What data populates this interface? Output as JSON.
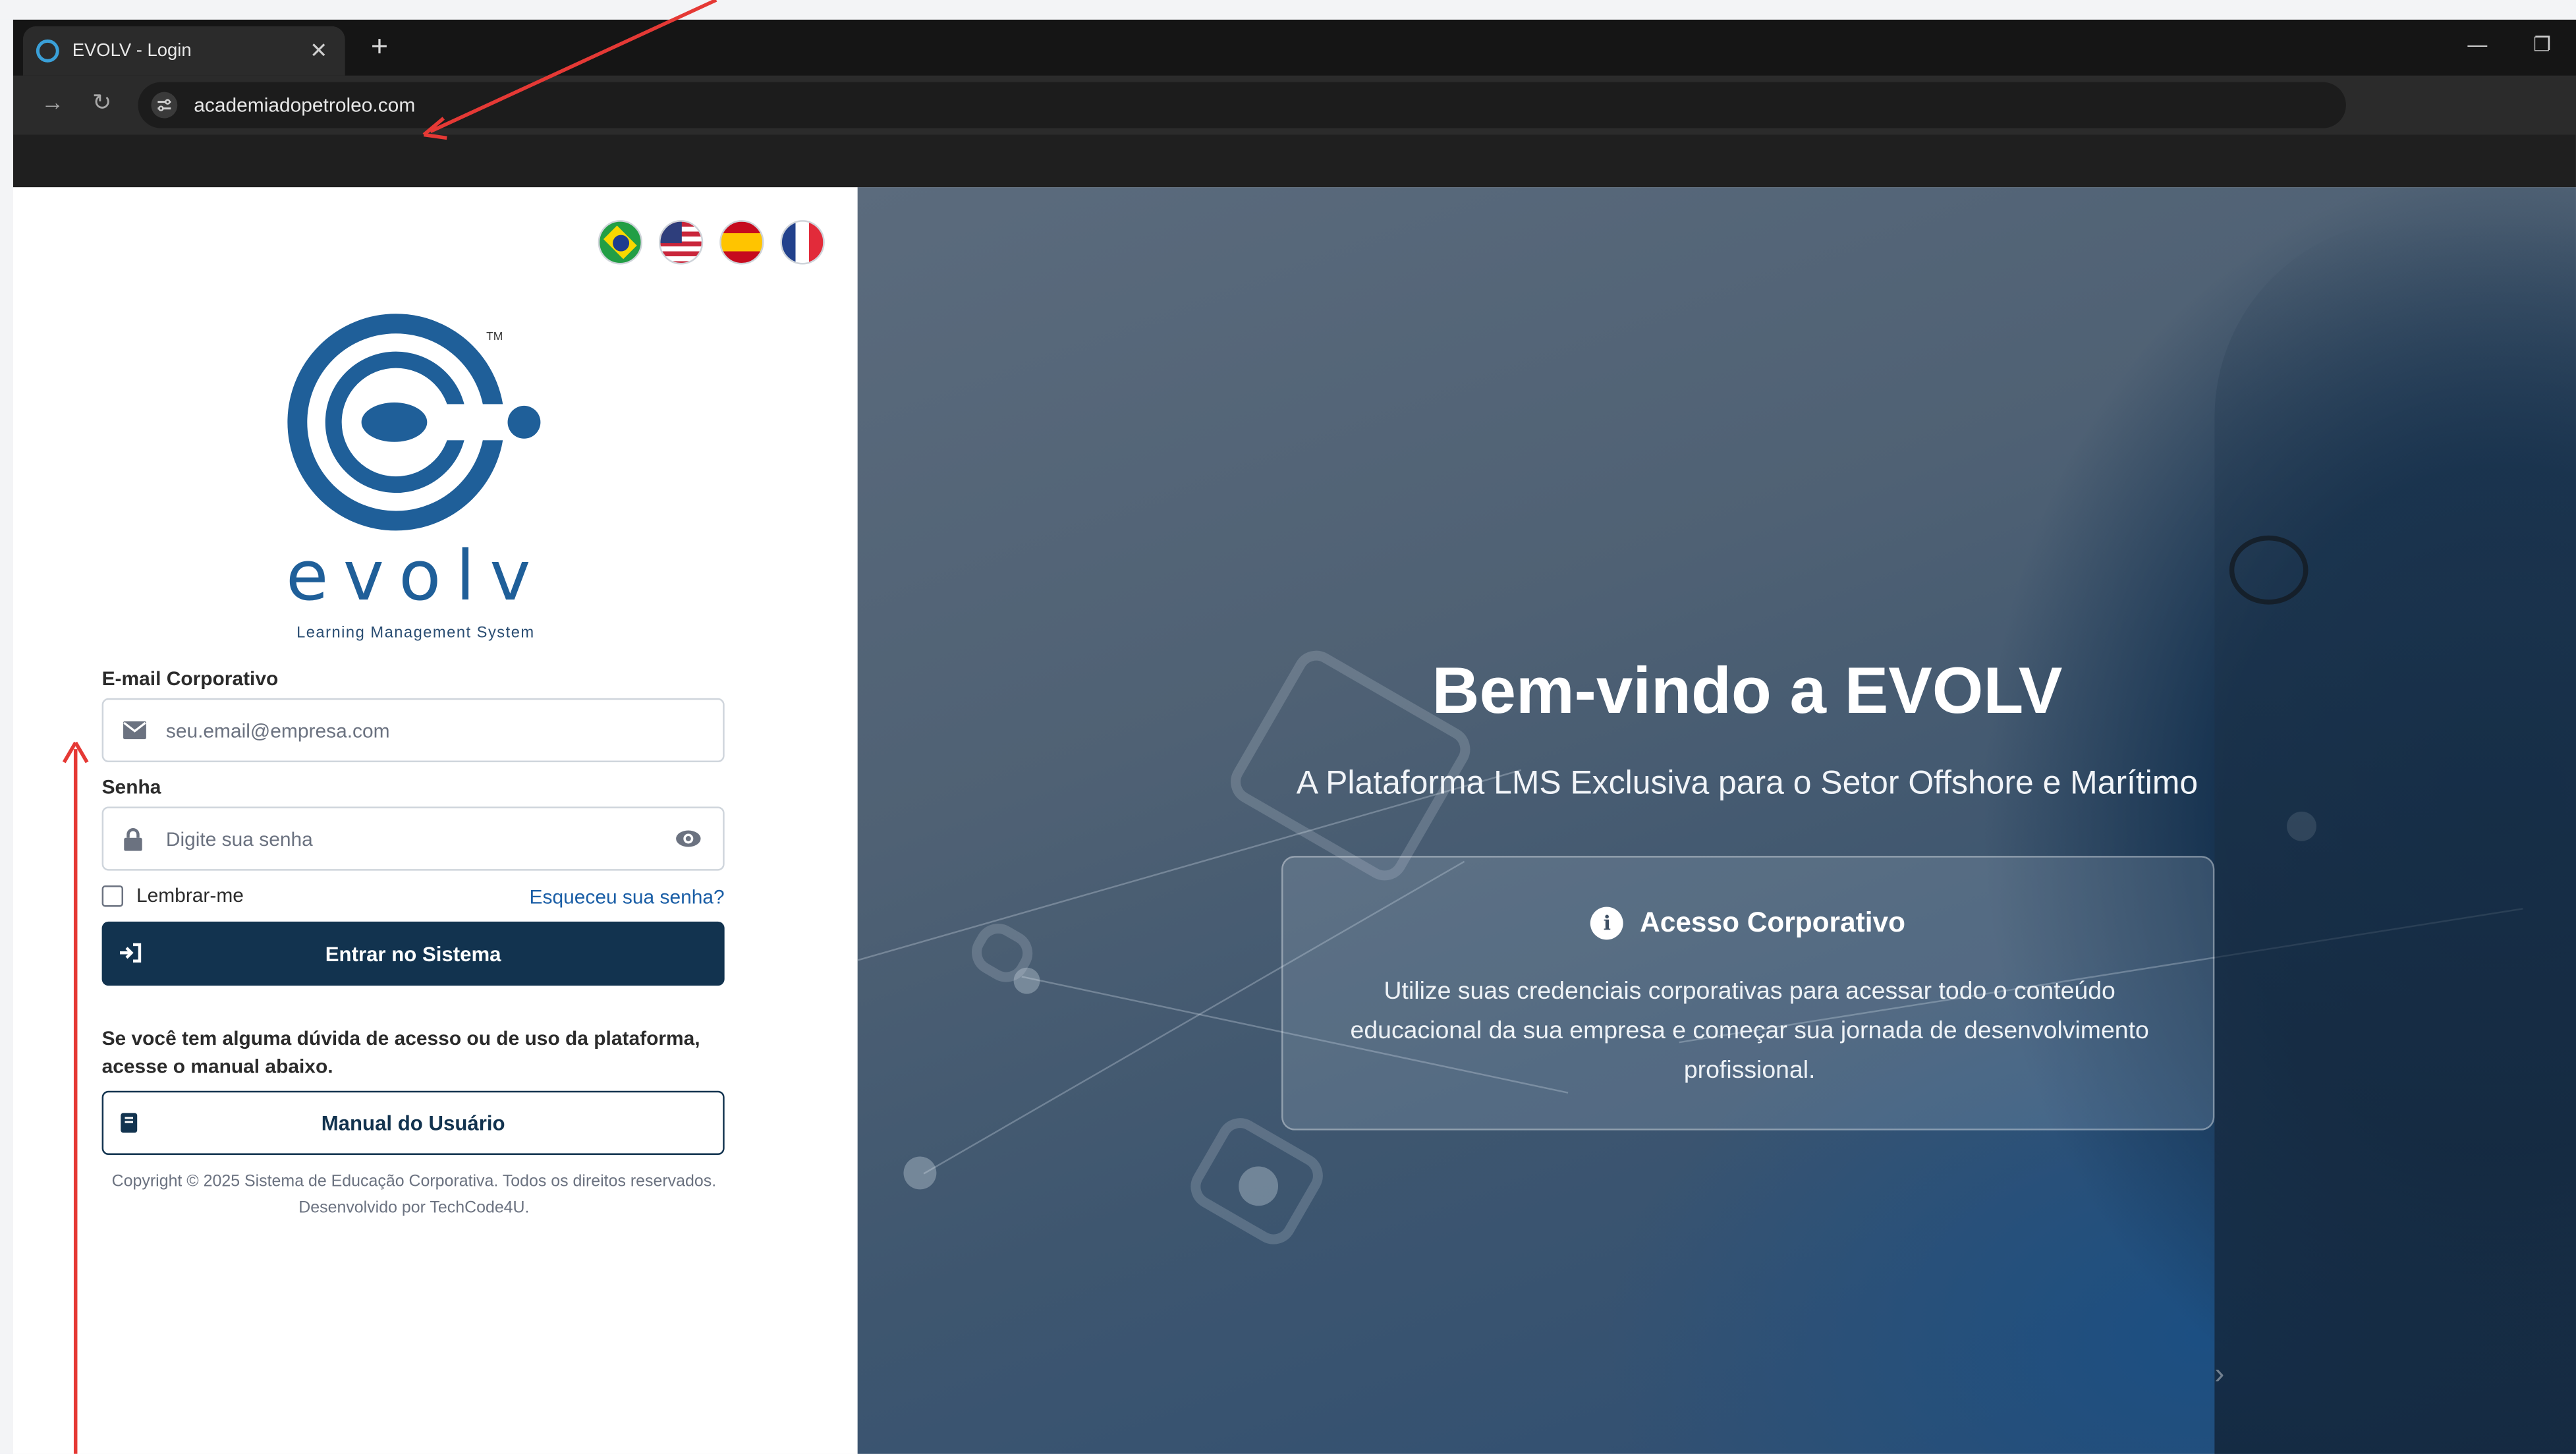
{
  "browser": {
    "tab_title": "EVOLV - Login",
    "tab_close": "✕",
    "new_tab": "+",
    "url": "academiadopetroleo.com",
    "forward_glyph": "→",
    "reload_glyph": "↻",
    "minimize_glyph": "—",
    "restore_glyph": "❐"
  },
  "languages": [
    {
      "icon": "brazil-flag-icon"
    },
    {
      "icon": "usa-flag-icon"
    },
    {
      "icon": "spain-flag-icon"
    },
    {
      "icon": "france-flag-icon"
    }
  ],
  "logo": {
    "wordmark": "evolv",
    "tagline": "Learning Management System",
    "trademark": "TM",
    "colors": {
      "primary": "#1f5f99"
    }
  },
  "form": {
    "email_label": "E-mail Corporativo",
    "email_placeholder": "seu.email@empresa.com",
    "password_label": "Senha",
    "password_placeholder": "Digite sua senha",
    "remember_label": "Lembrar-me",
    "forgot_link": "Esqueceu sua senha?",
    "login_button": "Entrar no Sistema",
    "help_text": "Se você tem alguma dúvida de acesso ou de uso da plataforma, acesse o manual abaixo.",
    "manual_button": "Manual do Usuário",
    "copyright": "Copyright © 2025 Sistema de Educação Corporativa. Todos os direitos reservados.",
    "developer": "Desenvolvido por TechCode4U."
  },
  "hero": {
    "title": "Bem-vindo a EVOLV",
    "subtitle": "A Plataforma LMS Exclusiva para o Setor Offshore e Marítimo",
    "card_title": "Acesso Corporativo",
    "card_icon_glyph": "i",
    "card_text": "Utilize suas credenciais corporativas para acessar todo o conteúdo educacional da sua empresa e começar sua jornada de desenvolvimento profissional."
  },
  "colors": {
    "button_primary": "#12334f",
    "link": "#1a5ea6",
    "annotation": "#e53935"
  }
}
